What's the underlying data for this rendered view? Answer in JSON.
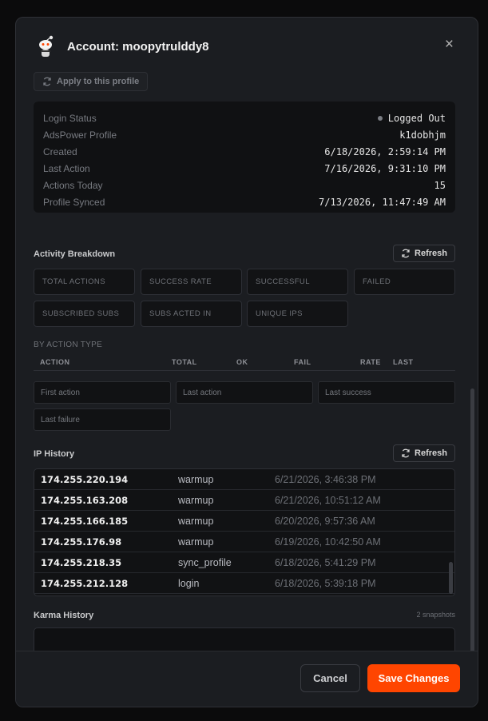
{
  "modal": {
    "title": "Account: moopytrulddy8",
    "close": "×"
  },
  "apply_button": "Apply to this profile",
  "status": [
    {
      "label": "Login Status",
      "value": "Logged Out"
    },
    {
      "label": "AdsPower Profile",
      "value": "k1dobhjm"
    },
    {
      "label": "Created",
      "value": "6/18/2026, 2:59:14 PM"
    },
    {
      "label": "Last Action",
      "value": "7/16/2026, 9:31:10 PM"
    },
    {
      "label": "Actions Today",
      "value": "15"
    },
    {
      "label": "Profile Synced",
      "value": "7/13/2026, 11:47:49 AM"
    }
  ],
  "activity": {
    "title": "Activity Breakdown",
    "refresh": "Refresh",
    "stats": [
      "TOTAL ACTIONS",
      "SUCCESS RATE",
      "SUCCESSFUL",
      "FAILED",
      "SUBSCRIBED SUBS",
      "SUBS ACTED IN",
      "UNIQUE IPS"
    ],
    "by_type_label": "BY ACTION TYPE",
    "columns": [
      "ACTION",
      "TOTAL",
      "OK",
      "FAIL",
      "RATE",
      "LAST"
    ],
    "mini": [
      "First action",
      "Last action",
      "Last success",
      "Last failure"
    ]
  },
  "ip_history": {
    "title": "IP History",
    "refresh": "Refresh",
    "rows": [
      {
        "ip": "174.255.220.194",
        "action": "warmup",
        "time": "6/21/2026, 3:46:38 PM"
      },
      {
        "ip": "174.255.163.208",
        "action": "warmup",
        "time": "6/21/2026, 10:51:12 AM"
      },
      {
        "ip": "174.255.166.185",
        "action": "warmup",
        "time": "6/20/2026, 9:57:36 AM"
      },
      {
        "ip": "174.255.176.98",
        "action": "warmup",
        "time": "6/19/2026, 10:42:50 AM"
      },
      {
        "ip": "174.255.218.35",
        "action": "sync_profile",
        "time": "6/18/2026, 5:41:29 PM"
      },
      {
        "ip": "174.255.212.128",
        "action": "login",
        "time": "6/18/2026, 5:39:18 PM"
      }
    ]
  },
  "karma": {
    "title": "Karma History",
    "snapshots": "2 snapshots"
  },
  "footer": {
    "cancel": "Cancel",
    "save": "Save Changes"
  },
  "colors": {
    "accent": "#ff4500",
    "panel": "#1b1d21"
  }
}
